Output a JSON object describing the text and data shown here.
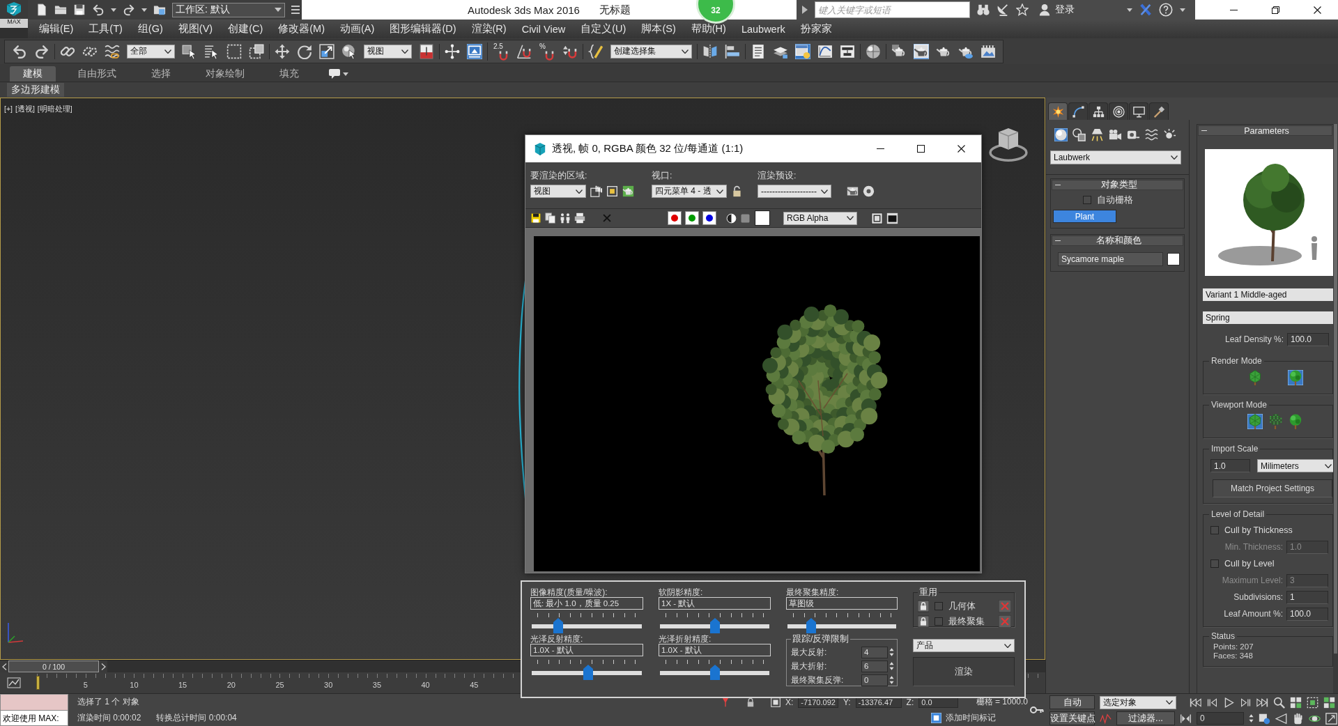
{
  "title_bar": {
    "logo": "MAX",
    "workspace": "工作区: 默认",
    "app_title": "Autodesk 3ds Max 2016",
    "document": "无标题",
    "badge": "32",
    "search_placeholder": "键入关键字或短语",
    "sign_in": "登录"
  },
  "menu": [
    "编辑(E)",
    "工具(T)",
    "组(G)",
    "视图(V)",
    "创建(C)",
    "修改器(M)",
    "动画(A)",
    "图形编辑器(D)",
    "渲染(R)",
    "Civil View",
    "自定义(U)",
    "脚本(S)",
    "帮助(H)",
    "Laubwerk",
    "扮家家"
  ],
  "main_toolbar": [
    [
      {
        "kind": "undo",
        "active": false
      },
      {
        "kind": "redo",
        "active": false
      }
    ],
    [
      {
        "kind": "link",
        "active": false
      },
      {
        "kind": "unlink",
        "active": false
      },
      {
        "kind": "wave-link",
        "active": false
      },
      {
        "kind": "dropdown",
        "value": "全部"
      },
      {
        "kind": "box-cursor",
        "active": false
      },
      {
        "kind": "list-cursor",
        "active": false
      },
      {
        "kind": "dashed-rect",
        "active": false
      },
      {
        "kind": "crossing-rect",
        "active": false
      }
    ],
    [
      {
        "kind": "move",
        "active": false
      },
      {
        "kind": "rotate",
        "active": false
      },
      {
        "kind": "scale",
        "active": false
      },
      {
        "kind": "sphere-cursor",
        "active": false
      },
      {
        "kind": "dropdown",
        "value": "视图"
      },
      {
        "kind": "split-box",
        "active": false
      }
    ],
    [
      {
        "kind": "cross-dots",
        "active": false
      },
      {
        "kind": "screen-arrow",
        "active": true
      }
    ],
    [
      {
        "kind": "magnet",
        "label": "2.5",
        "active": false
      },
      {
        "kind": "angle-magnet",
        "active": false
      },
      {
        "kind": "magnet",
        "label": "%",
        "active": false
      },
      {
        "kind": "spinner-magnet",
        "active": false
      }
    ],
    [
      {
        "kind": "brace-pencil",
        "active": false
      },
      {
        "kind": "dropdown",
        "value": "创建选择集"
      }
    ],
    [
      {
        "kind": "mirror",
        "active": false
      },
      {
        "kind": "align",
        "active": false
      }
    ],
    [
      {
        "kind": "list",
        "active": false
      },
      {
        "kind": "layers",
        "active": false
      },
      {
        "kind": "window-bulb",
        "active": true
      },
      {
        "kind": "curve-graph",
        "active": false
      },
      {
        "kind": "schematic",
        "active": false
      }
    ],
    [
      {
        "kind": "material-sphere",
        "active": false
      }
    ],
    [
      {
        "kind": "teapot-panel",
        "active": false
      },
      {
        "kind": "teapot-window",
        "active": true
      },
      {
        "kind": "teapot",
        "active": false
      },
      {
        "kind": "teapot-cloud",
        "active": false
      },
      {
        "kind": "picture",
        "active": false
      }
    ]
  ],
  "ribbon": {
    "tabs": [
      {
        "label": "建模",
        "selected": true
      },
      {
        "label": "自由形式",
        "selected": false
      },
      {
        "label": "选择",
        "selected": false
      },
      {
        "label": "对象绘制",
        "selected": false
      },
      {
        "label": "填充",
        "selected": false
      }
    ],
    "panel": "多边形建模"
  },
  "viewport": {
    "labels": [
      "[+]",
      "[透视]",
      "[明暗处理]"
    ]
  },
  "render_frame": {
    "title": "透视, 帧 0, RGBA 颜色 32 位/每通道 (1:1)",
    "area": {
      "label": "要渲染的区域:",
      "value": "视图"
    },
    "view": {
      "label": "视口:",
      "value": "四元菜单 4 - 透"
    },
    "preset": {
      "label": "渲染预设:",
      "value": "--------------------"
    },
    "channels": [
      {
        "color": "#e00000",
        "on": true
      },
      {
        "color": "#009a00",
        "on": true
      },
      {
        "color": "#0000e0",
        "on": true
      }
    ],
    "display": "RGB Alpha"
  },
  "render_settings": {
    "sliders": [
      {
        "label": "图像精度(质量/噪波):",
        "value": "低: 最小 1.0，质量 0.25",
        "level": 0.24
      },
      {
        "label": "软阴影精度:",
        "value": "1X - 默认",
        "level": 0.5
      },
      {
        "label": "最终聚集精度:",
        "value": "草图级",
        "level": 0.22
      },
      {
        "label": "光泽反射精度:",
        "value": "1.0X - 默认",
        "level": 0.51
      },
      {
        "label": "光泽折射精度:",
        "value": "1.0X - 默认",
        "level": 0.5
      }
    ],
    "trace": {
      "title": "跟踪/反弹限制",
      "rows": [
        {
          "label": "最大反射:",
          "value": "4"
        },
        {
          "label": "最大折射:",
          "value": "6"
        },
        {
          "label": "最终聚集反弹:",
          "value": "0"
        }
      ]
    },
    "reuse": {
      "title": "重用",
      "rows": [
        {
          "label": "几何体",
          "checked": false
        },
        {
          "label": "最终聚集",
          "checked": false
        }
      ]
    },
    "mode": "产品",
    "render_button": "渲染"
  },
  "command_panel": {
    "tabs": [
      {
        "kind": "sun",
        "selected": true
      },
      {
        "kind": "curve-bend",
        "selected": false
      },
      {
        "kind": "hierarchy",
        "selected": false
      },
      {
        "kind": "target",
        "selected": false
      },
      {
        "kind": "monitor",
        "selected": false
      },
      {
        "kind": "hammer",
        "selected": false
      }
    ],
    "categories": [
      {
        "kind": "sphere",
        "selected": true
      },
      {
        "kind": "shapes",
        "selected": false
      },
      {
        "kind": "lamp",
        "selected": false
      },
      {
        "kind": "camera",
        "selected": false
      },
      {
        "kind": "tape",
        "selected": false
      },
      {
        "kind": "waves",
        "selected": false
      },
      {
        "kind": "sparks",
        "selected": false
      }
    ],
    "category_value": "Laubwerk",
    "object_type": {
      "title": "对象类型",
      "autogrid": {
        "label": "自动栅格",
        "checked": false
      },
      "buttons": [
        {
          "label": "Plant",
          "selected": true
        }
      ]
    },
    "name_color": {
      "title": "名称和颜色",
      "name": "Sycamore maple"
    }
  },
  "parameters": {
    "title": "Parameters",
    "variant": "Variant 1 Middle-aged",
    "season": "Spring",
    "leaf_density": {
      "label": "Leaf Density %:",
      "value": "100.0"
    },
    "render_mode": {
      "title": "Render Mode",
      "options": [
        {
          "kind": "faceted-tree",
          "selected": false
        },
        {
          "kind": "leafy-tree",
          "selected": true
        }
      ]
    },
    "viewport_mode": {
      "title": "Viewport Mode",
      "options": [
        {
          "kind": "faceted-tree",
          "selected": true
        },
        {
          "kind": "dotted-tree",
          "selected": false
        },
        {
          "kind": "leafy-tree",
          "selected": false
        }
      ]
    },
    "import_scale": {
      "title": "Import Scale",
      "value": "1.0",
      "unit": "Milimeters",
      "button": "Match Project Settings"
    },
    "level_of_detail": {
      "title": "Level of Detail",
      "rows": [
        {
          "kind": "checkbox",
          "label": "Cull by Thickness",
          "checked": false
        },
        {
          "kind": "field",
          "label": "Min. Thickness:",
          "value": "1.0",
          "disabled": true
        },
        {
          "kind": "checkbox",
          "label": "Cull by Level",
          "checked": false
        },
        {
          "kind": "field",
          "label": "Maximum Level:",
          "value": "3",
          "disabled": true
        },
        {
          "kind": "field",
          "label": "Subdivisions:",
          "value": "1",
          "disabled": false
        },
        {
          "kind": "field",
          "label": "Leaf Amount %:",
          "value": "100.0",
          "disabled": false
        }
      ]
    },
    "status": {
      "title": "Status",
      "lines": [
        "Points: 207",
        "Faces: 348"
      ]
    }
  },
  "timeline": {
    "position": "0 / 100",
    "level": 0,
    "ticks": [
      "5",
      "10",
      "15",
      "20",
      "25",
      "30",
      "35",
      "40",
      "45"
    ]
  },
  "status_bar": {
    "listener": "欢迎使用 MAX:",
    "prompt": "选择了 1 个 对象",
    "render_time": "渲染时间 0:00:02",
    "total_time": "转换总计时间 0:00:04",
    "coords": [
      {
        "label": "X:",
        "value": "-7170.092"
      },
      {
        "label": "Y:",
        "value": "-13376.47"
      },
      {
        "label": "Z:",
        "value": "0.0"
      }
    ],
    "grid": "栅格 = 1000.0",
    "time_tag": "添加时间标记"
  },
  "anim_controls": {
    "auto_key": "自动",
    "set_key": "设置关键点",
    "key_target": "选定对象",
    "filters": "过滤器...",
    "frame": "0"
  }
}
